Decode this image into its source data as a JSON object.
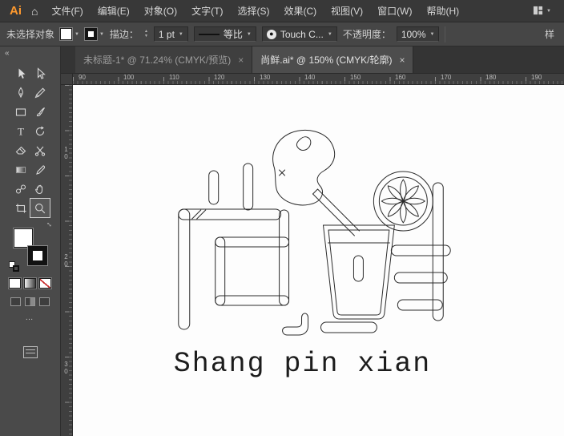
{
  "menubar": {
    "logo": "Ai",
    "items": [
      "文件(F)",
      "编辑(E)",
      "对象(O)",
      "文字(T)",
      "选择(S)",
      "效果(C)",
      "视图(V)",
      "窗口(W)",
      "帮助(H)"
    ]
  },
  "controlbar": {
    "selection_status": "未选择对象",
    "stroke_label": "描边：",
    "stroke_weight": "1 pt",
    "profile_label": "等比",
    "brush_name": "Touch C...",
    "opacity_label": "不透明度：",
    "opacity_value": "100%",
    "style_label": "样"
  },
  "tabs": [
    {
      "title": "未标题-1* @ 71.24% (CMYK/预览)",
      "close": "×"
    },
    {
      "title": "尚鲜.ai* @ 150% (CMYK/轮廓)",
      "close": "×"
    }
  ],
  "rulers": {
    "horizontal": [
      "90",
      "100",
      "110",
      "120",
      "130",
      "140",
      "150",
      "160",
      "170",
      "180",
      "190"
    ],
    "vertical": [
      "10",
      "20",
      "30"
    ]
  },
  "toolbar": {
    "collapse": "«",
    "more": "…",
    "tools": [
      "selection",
      "direct-selection",
      "pen",
      "pencil",
      "rectangle",
      "paintbrush",
      "type",
      "rotate",
      "eraser",
      "scissors",
      "gradient",
      "eyedropper",
      "blend",
      "hand",
      "artboard",
      "zoom"
    ],
    "selected_tool": "zoom"
  },
  "artboard": {
    "logo_text": "Shang pin xian"
  },
  "icons": {
    "home": "⌂",
    "caret": "▼",
    "spin_up": "▲",
    "spin_down": "▼",
    "swap": "↔",
    "type_glyph": "T"
  },
  "colors": {
    "accent": "#ff9a2e",
    "ui_bg": "#3a3a3a",
    "panel_bg": "#4a4a4a",
    "canvas_bg": "#fdfdfd",
    "line": "#2a2a2a"
  }
}
